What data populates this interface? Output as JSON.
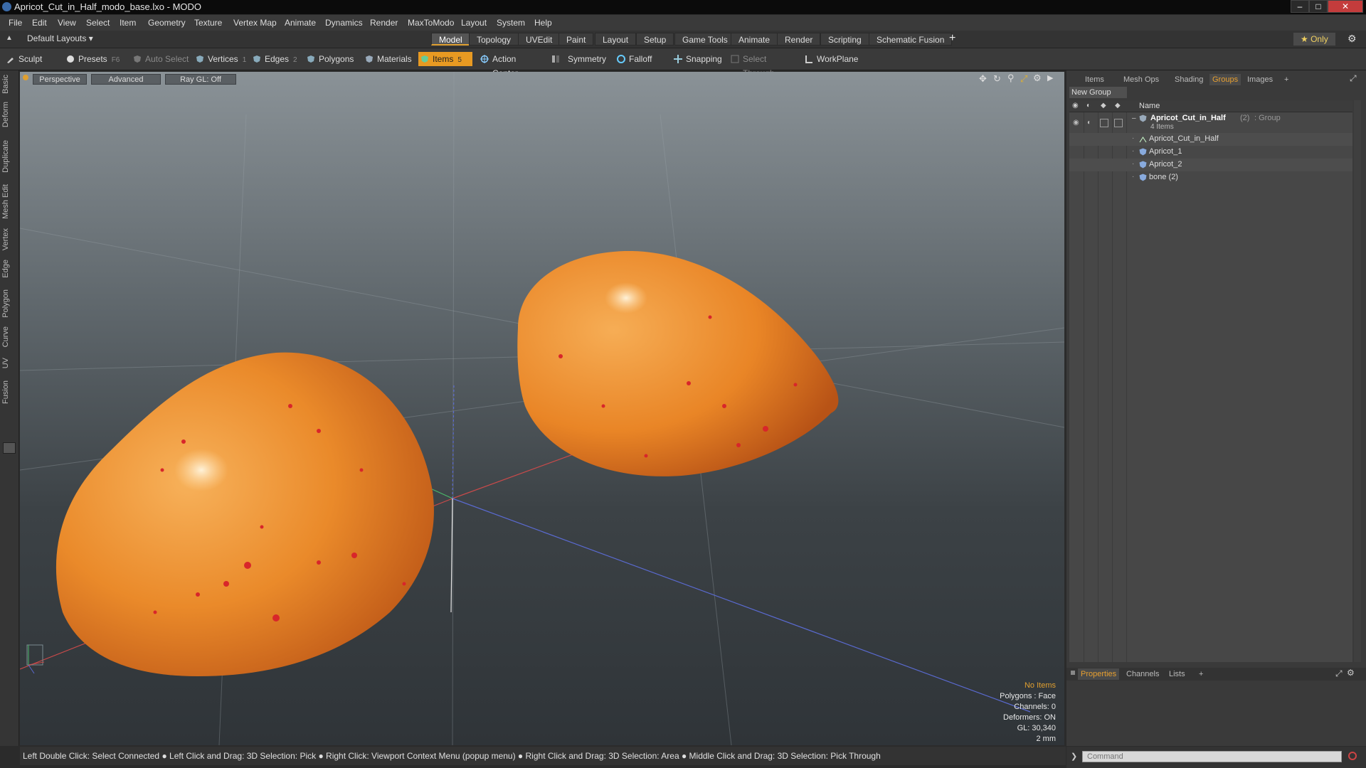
{
  "window": {
    "title": "Apricot_Cut_in_Half_modo_base.lxo - MODO",
    "controls": [
      "–",
      "□",
      "✕"
    ]
  },
  "menu": [
    "File",
    "Edit",
    "View",
    "Select",
    "Item",
    "Geometry",
    "Texture",
    "Vertex Map",
    "Animate",
    "Dynamics",
    "Render",
    "MaxToModo",
    "Layout",
    "System",
    "Help"
  ],
  "layoutbar": {
    "layout_select": "Default Layouts ▾",
    "tabs": [
      "Model",
      "Topology",
      "UVEdit",
      "Paint",
      "Layout",
      "Setup",
      "Game Tools",
      "Animate",
      "Render",
      "Scripting",
      "Schematic Fusion"
    ],
    "active_tab": "Model",
    "add": "+",
    "only": "★ Only"
  },
  "toolbar": {
    "sculpt": "Sculpt",
    "presets": "Presets",
    "presets_key": "F6",
    "auto_select": "Auto Select",
    "vertices": "Vertices",
    "vertices_count": "1",
    "edges": "Edges",
    "edges_count": "2",
    "polygons": "Polygons",
    "materials": "Materials",
    "items": "Items",
    "items_count": "5",
    "action_center": "Action Center",
    "symmetry": "Symmetry",
    "falloff": "Falloff",
    "snapping": "Snapping",
    "select_through": "Select Through",
    "workplane": "WorkPlane"
  },
  "left_tabs": [
    "Basic",
    "Deform",
    "Duplicate",
    "Mesh Edit",
    "Vertex",
    "Edge",
    "Polygon",
    "Curve",
    "UV",
    "Fusion"
  ],
  "viewport": {
    "view": "Perspective",
    "mode": "Advanced",
    "raygl": "Ray GL: Off",
    "info": {
      "selection": "No Items",
      "polygons": "Polygons : Face",
      "channels": "Channels: 0",
      "deformers": "Deformers: ON",
      "gl": "GL: 30,340",
      "scale": "2 mm"
    },
    "colors": {
      "fruit": "#e98a2a",
      "highlight": "#f3b25a",
      "spots": "#d8262a",
      "x_axis": "#c94a4a",
      "y_axis": "#4ab86a",
      "z_axis": "#5a6ad0"
    }
  },
  "right_panel": {
    "tabs": [
      "Items",
      "Mesh Ops",
      "Shading",
      "Groups",
      "Images",
      "+"
    ],
    "active_tab": "Groups",
    "new_group": "New Group",
    "name_header": "Name",
    "group_name": "Apricot_Cut_in_Half",
    "group_count": "(2)",
    "group_type": ": Group",
    "group_items": "4 Items",
    "items": [
      "Apricot_Cut_in_Half",
      "Apricot_1",
      "Apricot_2",
      "bone (2)"
    ]
  },
  "props_panel": {
    "tabs": [
      "Properties",
      "Channels",
      "Lists",
      "+"
    ],
    "active_tab": "Properties"
  },
  "status": "Left Double Click: Select Connected ● Left Click and Drag: 3D Selection: Pick ● Right Click: Viewport Context Menu (popup menu) ● Right Click and Drag: 3D Selection: Area ● Middle Click and Drag: 3D Selection: Pick Through",
  "command": {
    "placeholder": "Command"
  }
}
